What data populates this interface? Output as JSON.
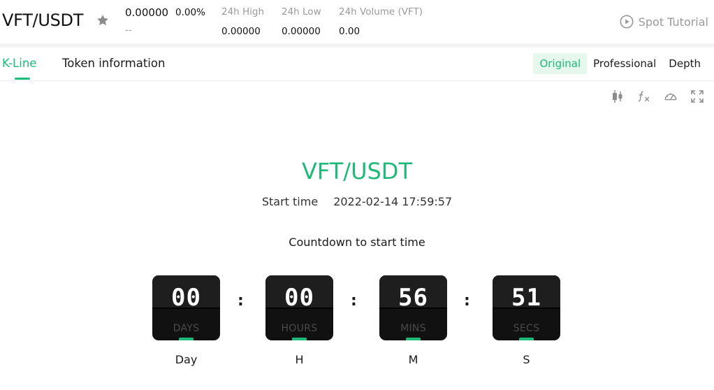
{
  "ticker": {
    "pair": "VFT/USDT",
    "price": "0.00000",
    "change": "0.00%",
    "price_sub": "--",
    "high_label": "24h High",
    "high_value": "0.00000",
    "low_label": "24h Low",
    "low_value": "0.00000",
    "volume_label": "24h Volume (VFT)",
    "volume_value": "0.00",
    "tutorial_label": "Spot Tutorial"
  },
  "tabs": {
    "kline": "K-Line",
    "token_info": "Token information"
  },
  "views": {
    "original": "Original",
    "professional": "Professional",
    "depth": "Depth"
  },
  "toolbar_icons": [
    "candlestick-icon",
    "function-icon",
    "gauge-icon",
    "fullscreen-icon"
  ],
  "countdown": {
    "title": "VFT/USDT",
    "start_label": "Start time",
    "start_value": "2022-02-14 17:59:57",
    "countdown_label": "Countdown to start time",
    "separator": ":",
    "units": [
      {
        "digits": "00",
        "tag": "DAYS",
        "caption": "Day"
      },
      {
        "digits": "00",
        "tag": "HOURS",
        "caption": "H"
      },
      {
        "digits": "56",
        "tag": "MINS",
        "caption": "M"
      },
      {
        "digits": "51",
        "tag": "SECS",
        "caption": "S"
      }
    ]
  },
  "colors": {
    "accent": "#1fba79",
    "accent_bg": "#e6f7ee",
    "muted": "#9a9a9a",
    "clock_bg": "#111111"
  }
}
